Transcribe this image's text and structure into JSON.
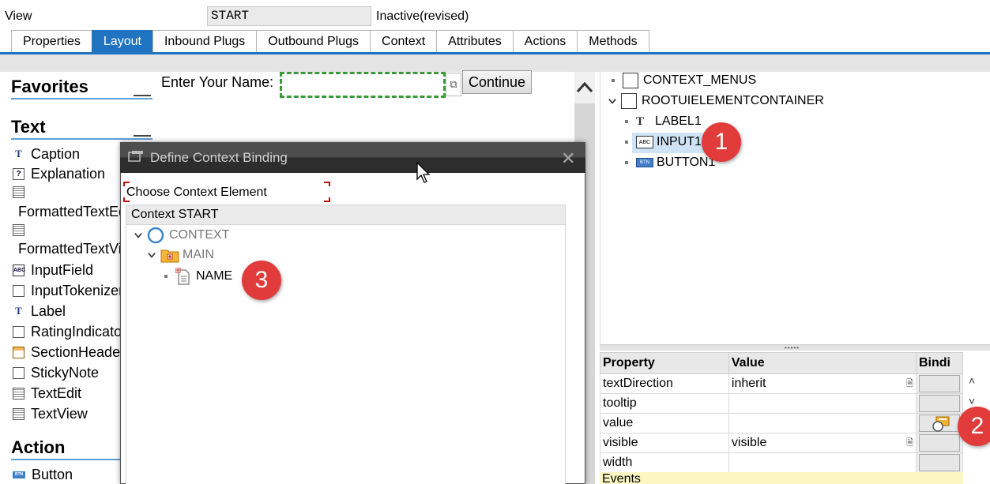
{
  "header": {
    "view_label": "View",
    "view_value": "START",
    "status": "Inactive(revised)"
  },
  "tabs": [
    {
      "label": "Properties",
      "active": false
    },
    {
      "label": "Layout",
      "active": true
    },
    {
      "label": "Inbound Plugs",
      "active": false
    },
    {
      "label": "Outbound Plugs",
      "active": false
    },
    {
      "label": "Context",
      "active": false
    },
    {
      "label": "Attributes",
      "active": false
    },
    {
      "label": "Actions",
      "active": false
    },
    {
      "label": "Methods",
      "active": false
    }
  ],
  "palette": {
    "favorites_title": "Favorites",
    "text_title": "Text",
    "text_items": [
      "Caption",
      "Explanation",
      "FormattedTextEdit",
      "FormattedTextView",
      "InputField",
      "InputTokenizer",
      "Label",
      "RatingIndicator",
      "SectionHeader",
      "StickyNote",
      "TextEdit",
      "TextView"
    ],
    "action_title": "Action",
    "action_items": [
      "Button"
    ]
  },
  "design": {
    "label_text": "Enter Your Name:",
    "input_value": "",
    "button_label": "Continue"
  },
  "element_tree": {
    "items": [
      {
        "label": "CONTEXT_MENUS"
      },
      {
        "label": "ROOTUIELEMENTCONTAINER"
      },
      {
        "label": "LABEL1"
      },
      {
        "label": "INPUT1"
      },
      {
        "label": "BUTTON1"
      }
    ]
  },
  "properties": {
    "headers": [
      "Property",
      "Value",
      "Bindi"
    ],
    "rows": [
      {
        "property": "textDirection",
        "value": "inherit"
      },
      {
        "property": "tooltip",
        "value": ""
      },
      {
        "property": "value",
        "value": ""
      },
      {
        "property": "visible",
        "value": "visible"
      },
      {
        "property": "width",
        "value": ""
      }
    ],
    "events_label": "Events"
  },
  "dialog": {
    "title": "Define Context Binding",
    "choose_label": "Choose Context Element",
    "context_header": "Context START",
    "tree": [
      "CONTEXT",
      "MAIN",
      "NAME"
    ]
  },
  "callouts": [
    "1",
    "2",
    "3"
  ],
  "colors": {
    "accent": "#1f73c1",
    "callout": "#e23b3b",
    "dialog_title": "#2d2d2d",
    "events_bg": "#fbf6c2"
  }
}
